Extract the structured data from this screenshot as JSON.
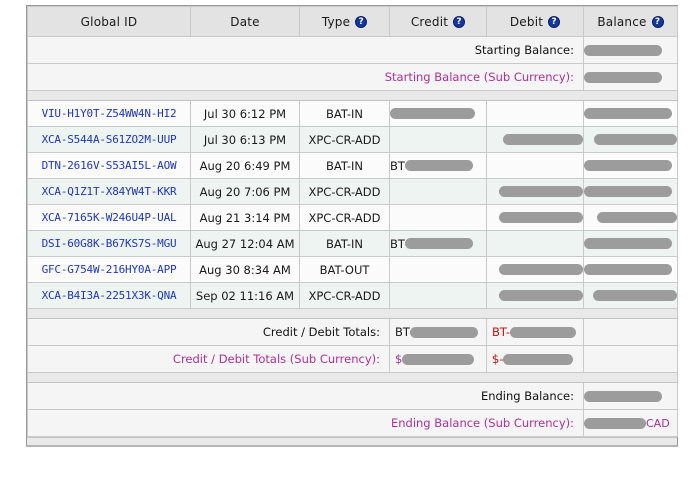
{
  "table": {
    "columns": [
      {
        "label": "Global ID",
        "help": false
      },
      {
        "label": "Date",
        "help": false
      },
      {
        "label": "Type",
        "help": true
      },
      {
        "label": "Credit",
        "help": true
      },
      {
        "label": "Debit",
        "help": true
      },
      {
        "label": "Balance",
        "help": true
      }
    ],
    "help_glyph": "?",
    "starting": {
      "label": "Starting Balance:",
      "sub_label": "Starting Balance (Sub Currency):",
      "value_redacted": true,
      "sub_value_redacted": true
    },
    "rows": [
      {
        "global_id": "VIU-H1Y0T-Z54WW4N-HI2",
        "date": "Jul 30 6:12 PM",
        "type": "BAT-IN",
        "credit": {
          "prefix": "",
          "redacted": true
        },
        "debit": {
          "prefix": "",
          "redacted": false
        },
        "balance": {
          "prefix": "",
          "redacted": true
        }
      },
      {
        "global_id": "XCA-S544A-S61ZO2M-UUP",
        "date": "Jul 30 6:13 PM",
        "type": "XPC-CR-ADD",
        "credit": {
          "prefix": "",
          "redacted": false
        },
        "debit": {
          "prefix": "",
          "redacted": true
        },
        "balance": {
          "prefix": "",
          "redacted": true
        }
      },
      {
        "global_id": "DTN-2616V-S53AI5L-AOW",
        "date": "Aug 20 6:49 PM",
        "type": "BAT-IN",
        "credit": {
          "prefix": "BT",
          "redacted": true
        },
        "debit": {
          "prefix": "",
          "redacted": false
        },
        "balance": {
          "prefix": "",
          "redacted": true
        }
      },
      {
        "global_id": "XCA-Q1Z1T-X84YW4T-KKR",
        "date": "Aug 20 7:06 PM",
        "type": "XPC-CR-ADD",
        "credit": {
          "prefix": "",
          "redacted": false
        },
        "debit": {
          "prefix": "",
          "redacted": true
        },
        "balance": {
          "prefix": "",
          "redacted": true
        }
      },
      {
        "global_id": "XCA-7165K-W246U4P-UAL",
        "date": "Aug 21 3:14 PM",
        "type": "XPC-CR-ADD",
        "credit": {
          "prefix": "",
          "redacted": false
        },
        "debit": {
          "prefix": "",
          "redacted": true
        },
        "balance": {
          "prefix": "",
          "redacted": true
        }
      },
      {
        "global_id": "DSI-60G8K-B67KS7S-MGU",
        "date": "Aug 27 12:04 AM",
        "type": "BAT-IN",
        "credit": {
          "prefix": "BT",
          "redacted": true
        },
        "debit": {
          "prefix": "",
          "redacted": false
        },
        "balance": {
          "prefix": "",
          "redacted": true
        }
      },
      {
        "global_id": "GFC-G754W-216HY0A-APP",
        "date": "Aug 30 8:34 AM",
        "type": "BAT-OUT",
        "credit": {
          "prefix": "",
          "redacted": false
        },
        "debit": {
          "prefix": "",
          "redacted": true
        },
        "balance": {
          "prefix": "",
          "redacted": true
        }
      },
      {
        "global_id": "XCA-B4I3A-2251X3K-QNA",
        "date": "Sep 02 11:16 AM",
        "type": "XPC-CR-ADD",
        "credit": {
          "prefix": "",
          "redacted": false
        },
        "debit": {
          "prefix": "",
          "redacted": true
        },
        "balance": {
          "prefix": "",
          "redacted": true
        }
      }
    ],
    "totals": {
      "label": "Credit / Debit Totals:",
      "sub_label": "Credit / Debit Totals (Sub Currency):",
      "credit_prefix": "BT",
      "debit_prefix": "BT-",
      "sub_credit_prefix": "$",
      "sub_debit_prefix": "$-"
    },
    "ending": {
      "label": "Ending Balance:",
      "sub_label": "Ending Balance (Sub Currency):",
      "sub_suffix": "CAD"
    }
  },
  "colors": {
    "link_blue": "#1d36c4",
    "magenta": "#b0309a",
    "negative_red": "#d01010",
    "redaction_gray": "#9c9c9c",
    "header_bg": "#e3e3e3",
    "row_alt_bg": "#eef4f1"
  }
}
